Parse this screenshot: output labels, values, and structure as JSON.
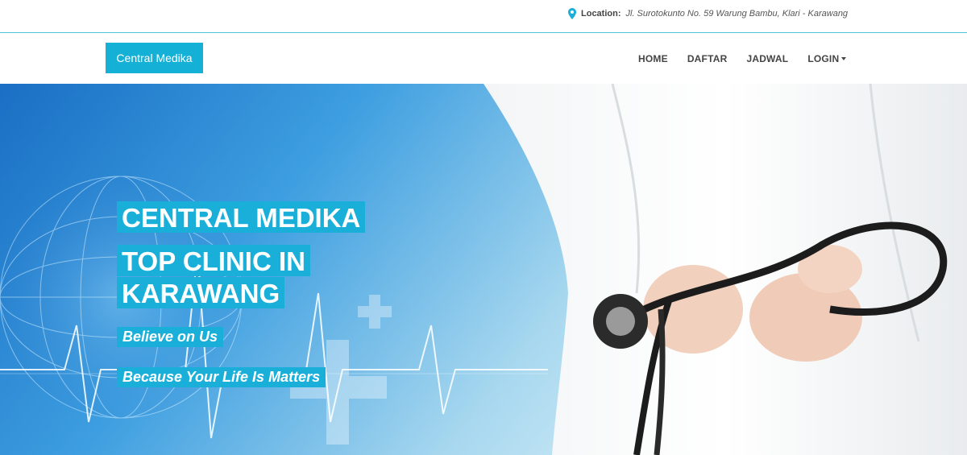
{
  "topbar": {
    "location_icon": "map-pin-icon",
    "location_label": "Location:",
    "location_value": "Jl. Surotokunto No. 59 Warung Bambu, Klari - Karawang"
  },
  "navbar": {
    "brand": "Central Medika",
    "items": [
      {
        "label": "HOME"
      },
      {
        "label": "DAFTAR"
      },
      {
        "label": "JADWAL"
      },
      {
        "label": "LOGIN"
      }
    ]
  },
  "hero": {
    "title_line1": "CENTRAL MEDIKA",
    "title_line2": "TOP CLINIC IN",
    "title_line3": "KARAWANG",
    "tagline1": "Believe on Us",
    "tagline2": "Because Your Life Is Matters"
  },
  "colors": {
    "accent": "#15b0d6",
    "topbar_border": "#4fc3d6"
  }
}
